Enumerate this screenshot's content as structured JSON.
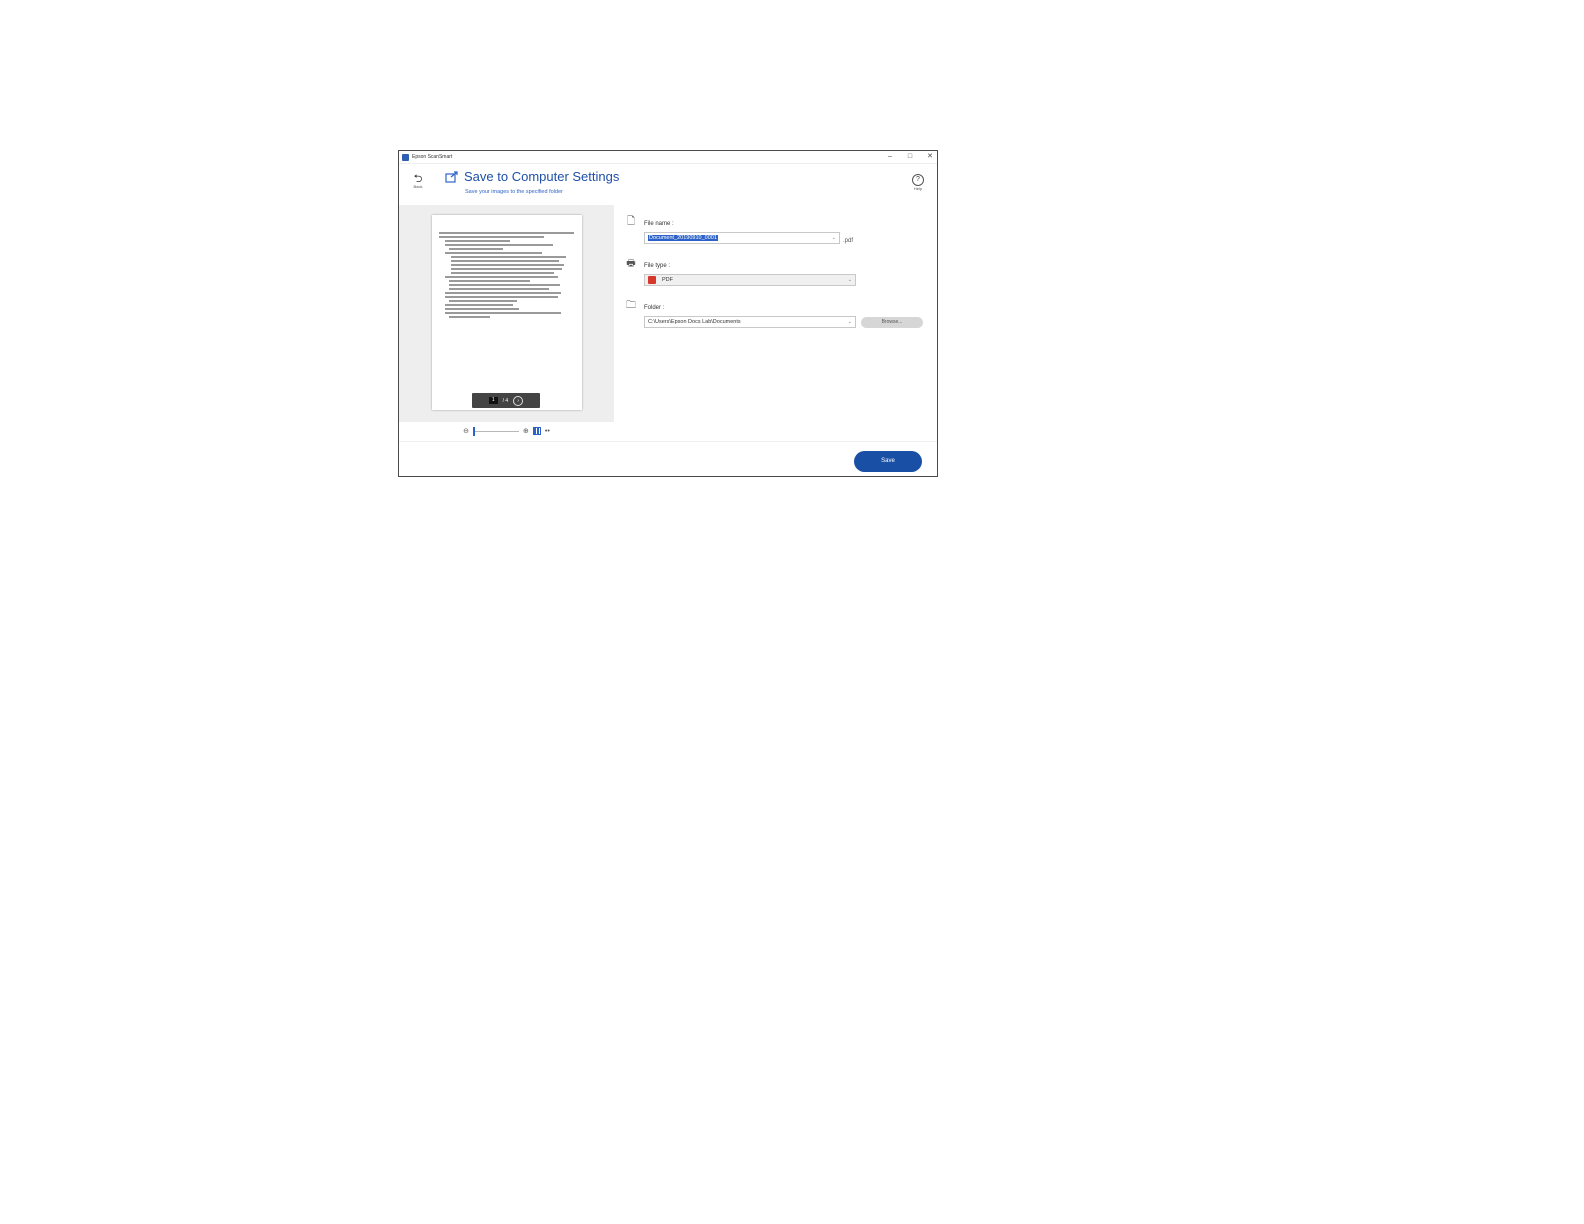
{
  "window": {
    "app_title": "Epson ScanSmart",
    "controls": {
      "minimize": "–",
      "maximize": "□",
      "close": "✕"
    }
  },
  "header": {
    "back_label": "Back",
    "title": "Save to Computer Settings",
    "subtitle": "Save your images to the specified folder",
    "help_label": "Help"
  },
  "preview": {
    "page_current": "1",
    "page_total": "/ 4"
  },
  "form": {
    "file_name": {
      "label": "File name :",
      "value": "Document_20190910_0001",
      "extension": ".pdf"
    },
    "file_type": {
      "label": "File type :",
      "value": "PDF"
    },
    "folder": {
      "label": "Folder :",
      "value": "C:\\Users\\Epson Docs Lab\\Documents",
      "browse_label": "Browse..."
    }
  },
  "footer": {
    "save_label": "Save"
  },
  "colors": {
    "accent": "#1a4fa6",
    "title": "#1e4fa8",
    "pdf_icon": "#d7372c"
  }
}
